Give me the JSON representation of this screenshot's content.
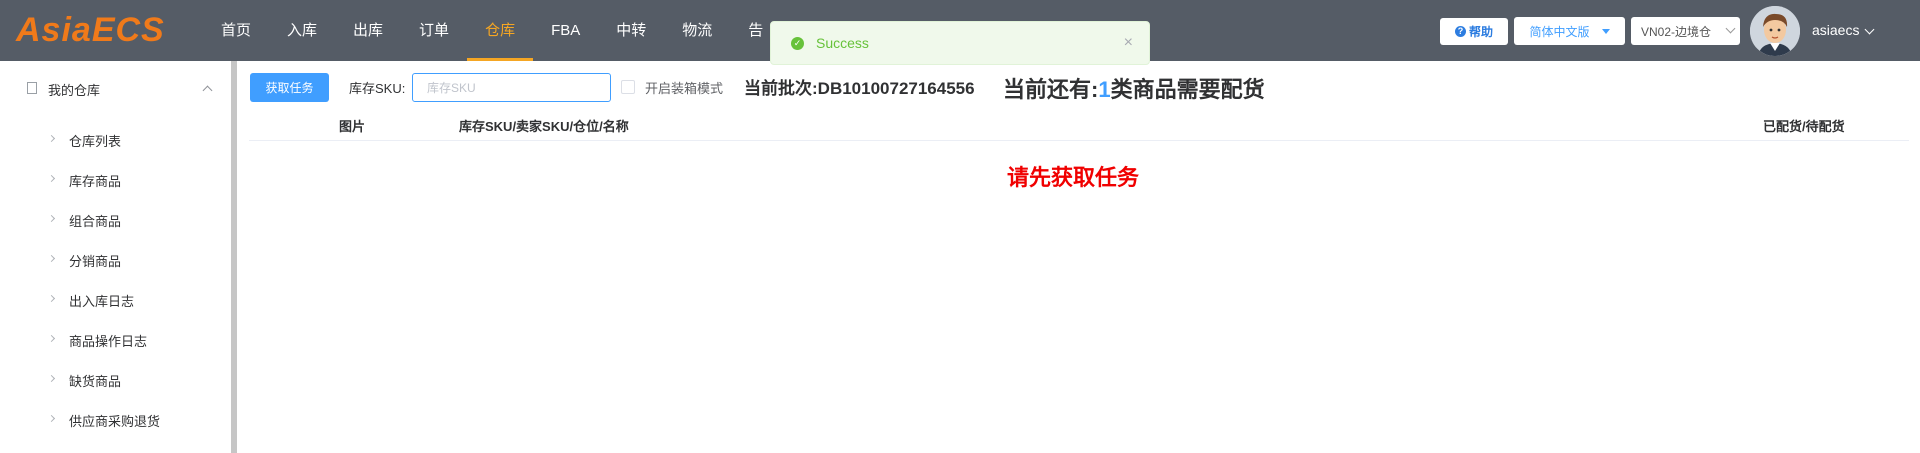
{
  "header": {
    "logo": "AsiaECS",
    "nav": [
      "首页",
      "入库",
      "出库",
      "订单",
      "仓库",
      "FBA",
      "中转",
      "物流",
      "告"
    ],
    "active_nav": "仓库",
    "help_label": "帮助",
    "language": "简体中文版",
    "warehouse": "VN02-边境仓",
    "username": "asiaecs"
  },
  "toast": {
    "message": "Success",
    "close": "×"
  },
  "sidebar": {
    "title": "我的仓库",
    "items": [
      "仓库列表",
      "库存商品",
      "组合商品",
      "分销商品",
      "出入库日志",
      "商品操作日志",
      "缺货商品",
      "供应商采购退货"
    ]
  },
  "toolbar": {
    "get_task_label": "获取任务",
    "sku_label": "库存SKU:",
    "sku_value": "",
    "sku_placeholder": "库存SKU",
    "boxing_mode_label": "开启装箱模式",
    "boxing_mode_checked": false,
    "batch_text": "当前批次:DB10100727164556",
    "remain_prefix": "当前还有:",
    "remain_count": "1",
    "remain_suffix": "类商品需要配货"
  },
  "table": {
    "columns": [
      "图片",
      "库存SKU/卖家SKU/仓位/名称",
      "已配货/待配货"
    ],
    "empty_message": "请先获取任务"
  },
  "colors": {
    "topbar": "#555c66",
    "accent": "#409eff",
    "active_nav": "#f5a623",
    "logo": "#f07a1a",
    "success": "#67c23a",
    "alert": "#f00000"
  }
}
